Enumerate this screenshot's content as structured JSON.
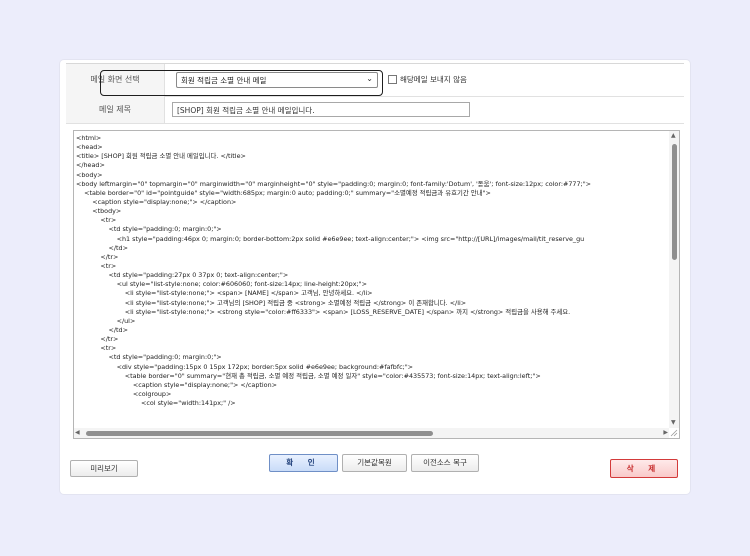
{
  "form": {
    "screen_select_label": "메일 화면 선택",
    "screen_select_value": "회원 적립금 소멸 안내 메일",
    "no_send_checkbox_label": "해당메일 보내지 않음",
    "mail_title_label": "메일 제목",
    "mail_title_value": "[SHOP] 회원 적립금 소멸 안내 메일입니다."
  },
  "editor": {
    "lines": [
      "<html>",
      "<head>",
      "<title> [SHOP] 회원 적립금 소멸 안내 메일입니다. </title>",
      "</head>",
      "<body>",
      "<body leftmargin=\"0\" topmargin=\"0\" marginwidth=\"0\" marginheight=\"0\" style=\"padding:0; margin:0; font-family:'Dotum', '돋움'; font-size:12px; color:#777;\">",
      "    <table border=\"0\" id=\"pointguide\" style=\"width:685px; margin:0 auto; padding:0;\" summary=\"소멸예정 적립금과 유효기간 안내\">",
      "        <caption style=\"display:none;\"> </caption>",
      "        <tbody>",
      "            <tr>",
      "                <td style=\"padding:0; margin:0;\">",
      "                    <h1 style=\"padding:46px 0; margin:0; border-bottom:2px solid #e6e9ee; text-align:center;\"> <img src=\"http://[URL]/images/mail/tit_reserve_gu",
      "                </td>",
      "            </tr>",
      "            <tr>",
      "                <td style=\"padding:27px 0 37px 0; text-align:center;\">",
      "                    <ul style=\"list-style:none; color:#606060; font-size:14px; line-height:20px;\">",
      "                        <li style=\"list-style:none;\"> <span> [NAME] </span> 고객님, 안녕하세요. </li>",
      "                        <li style=\"list-style:none;\"> 고객님의 [SHOP] 적립금 중 <strong> 소멸예정 적립금 </strong> 이 존재합니다. </li>",
      "                        <li style=\"list-style:none;\"> <strong style=\"color:#ff6333\"> <span> [LOSS_RESERVE_DATE] </span> 까지 </strong> 적립금을 사용해 주세요.",
      "                    </ul>",
      "                </td>",
      "            </tr>",
      "            <tr>",
      "                <td style=\"padding:0; margin:0;\">",
      "                    <div style=\"padding:15px 0 15px 172px; border:5px solid #e6e9ee; background:#fafbfc;\">",
      "                        <table border=\"0\" summary=\"현재 총 적립금, 소멸 예정 적립금, 소멸 예정 일자\" style=\"color:#435573; font-size:14px; text-align:left;\">",
      "                            <caption style=\"display:none;\"> </caption>",
      "                            <colgroup>",
      "                                <col style=\"width:141px;\" />"
    ]
  },
  "buttons": {
    "preview": "미리보기",
    "confirm": "확 인",
    "restore_default": "기본값복원",
    "restore_previous": "이전소스 복구",
    "delete": "삭 제"
  }
}
